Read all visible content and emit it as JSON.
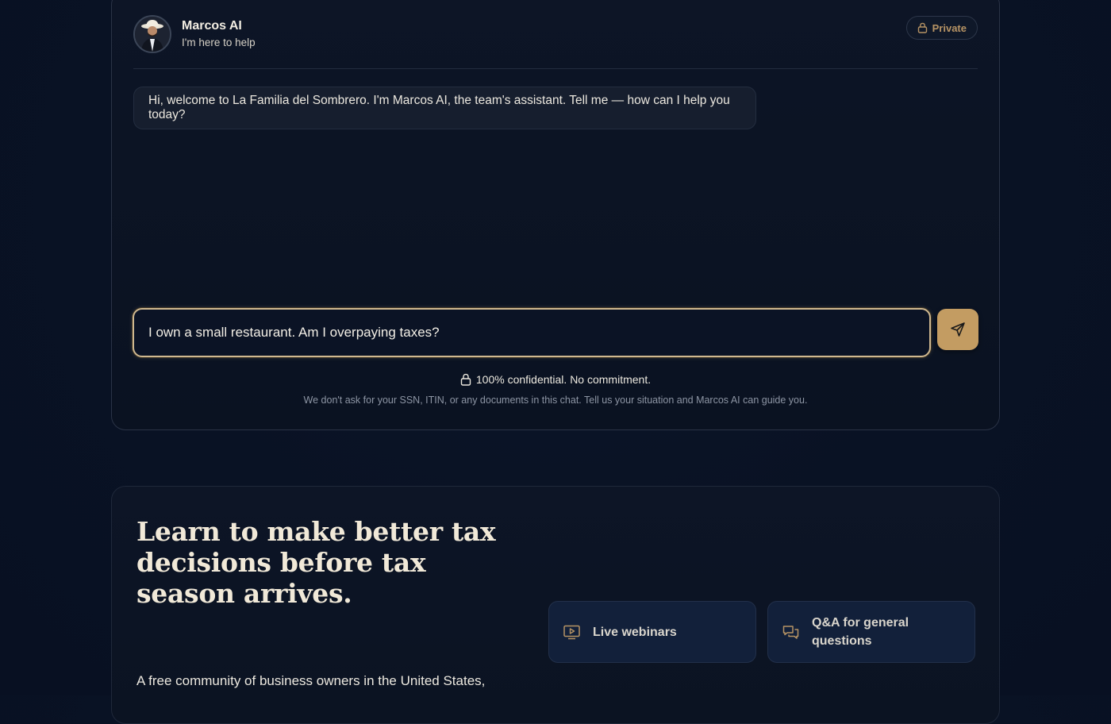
{
  "chat": {
    "agent_name": "Marcos AI",
    "agent_subtitle": "I'm here to help",
    "private_label": "Private",
    "greeting": "Hi, welcome to La Familia del Sombrero. I'm Marcos AI, the team's assistant. Tell me — how can I help you today?",
    "input_value": "I own a small restaurant. Am I overpaying taxes?",
    "confidential_label": "100% confidential. No commitment.",
    "privacy_note": "We don't ask for your SSN, ITIN, or any documents in this chat. Tell us your situation and Marcos AI can guide you."
  },
  "learn": {
    "title": "Learn to make better tax decisions before tax season arrives.",
    "description": "A free community of business owners in the United States,",
    "features": [
      {
        "label": "Live webinars",
        "icon": "video-icon"
      },
      {
        "label": "Q&A for general questions",
        "icon": "chat-icon"
      }
    ]
  },
  "colors": {
    "accent_gold": "#c39c62",
    "background": "#091224",
    "card_border": "#2a3346"
  }
}
